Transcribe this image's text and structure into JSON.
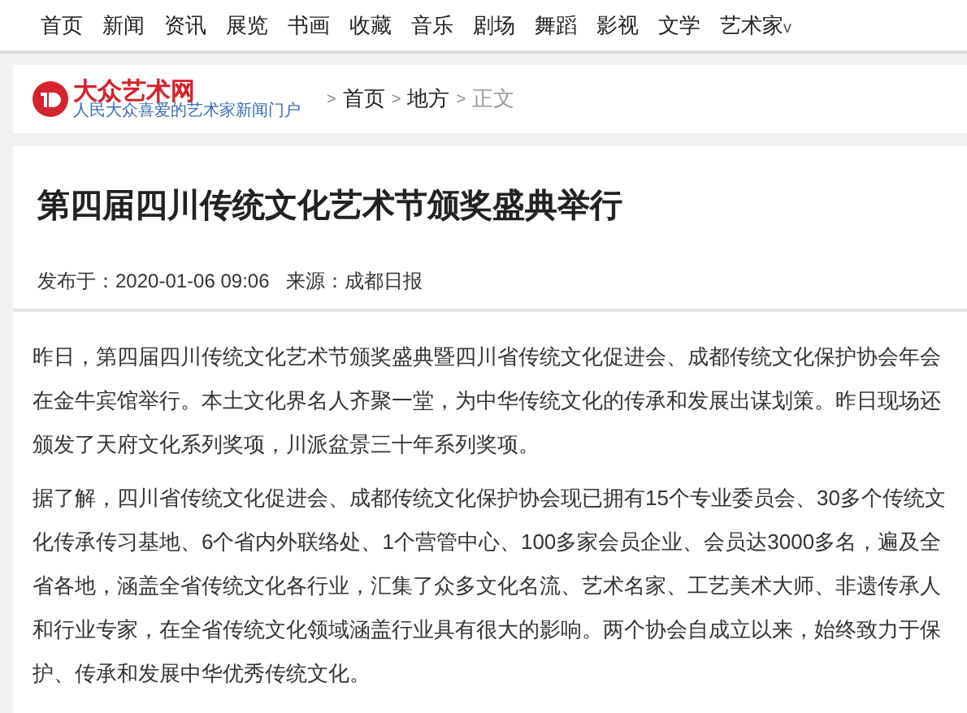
{
  "nav": {
    "items": [
      {
        "label": "首页"
      },
      {
        "label": "新闻"
      },
      {
        "label": "资讯"
      },
      {
        "label": "展览"
      },
      {
        "label": "书画"
      },
      {
        "label": "收藏"
      },
      {
        "label": "音乐"
      },
      {
        "label": "剧场"
      },
      {
        "label": "舞蹈"
      },
      {
        "label": "影视"
      },
      {
        "label": "文学"
      },
      {
        "label": "艺术家",
        "caret": "v"
      }
    ]
  },
  "header": {
    "logo_name": "大众艺术网",
    "logo_slogan": "人民大众喜爱的艺术家新闻门户",
    "breadcrumb": [
      {
        "label": "首页",
        "current": false
      },
      {
        "label": "地方",
        "current": false
      },
      {
        "label": "正文",
        "current": true
      }
    ],
    "separator": ">"
  },
  "article": {
    "title": "第四届四川传统文化艺术节颁奖盛典举行",
    "published": "发布于：2020-01-06 09:06",
    "source": "来源：成都日报",
    "paragraphs": [
      "昨日，第四届四川传统文化艺术节颁奖盛典暨四川省传统文化促进会、成都传统文化保护协会年会在金牛宾馆举行。本土文化界名人齐聚一堂，为中华传统文化的传承和发展出谋划策。昨日现场还颁发了天府文化系列奖项，川派盆景三十年系列奖项。",
      "据了解，四川省传统文化促进会、成都传统文化保护协会现已拥有15个专业委员会、30多个传统文化传承传习基地、6个省内外联络处、1个营管中心、100多家会员企业、会员达3000多名，遍及全省各地，涵盖全省传统文化各行业，汇集了众多文化名流、艺术名家、工艺美术大师、非遗传承人和行业专家，在全省传统文化领域涵盖行业具有很大的影响。两个协会自成立以来，始终致力于保护、传承和发展中华优秀传统文化。"
    ]
  }
}
